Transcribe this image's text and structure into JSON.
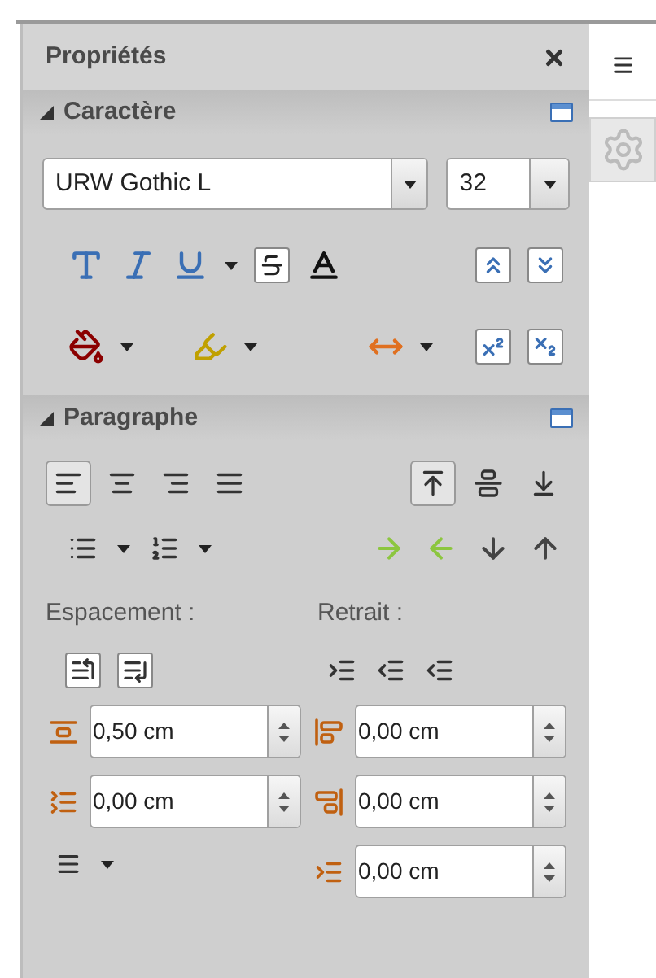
{
  "panel": {
    "title": "Propriétés"
  },
  "character": {
    "title": "Caractère",
    "expanded": true,
    "font": "URW Gothic L",
    "size": "32"
  },
  "paragraph": {
    "title": "Paragraphe",
    "expanded": true,
    "alignment": [
      {
        "selected": true
      },
      {
        "selected": false
      },
      {
        "selected": false
      },
      {
        "selected": false
      }
    ],
    "vertical_alignment": [
      {
        "selected": true
      },
      {
        "selected": false
      },
      {
        "selected": false
      }
    ],
    "spacing_label": "Espacement :",
    "indent_label": "Retrait :",
    "spacing_fields": [
      {
        "value": "0,50 cm"
      },
      {
        "value": "0,00 cm"
      }
    ],
    "indent_fields": [
      {
        "value": "0,00 cm"
      },
      {
        "value": "0,00 cm"
      },
      {
        "value": "0,00 cm"
      }
    ]
  }
}
